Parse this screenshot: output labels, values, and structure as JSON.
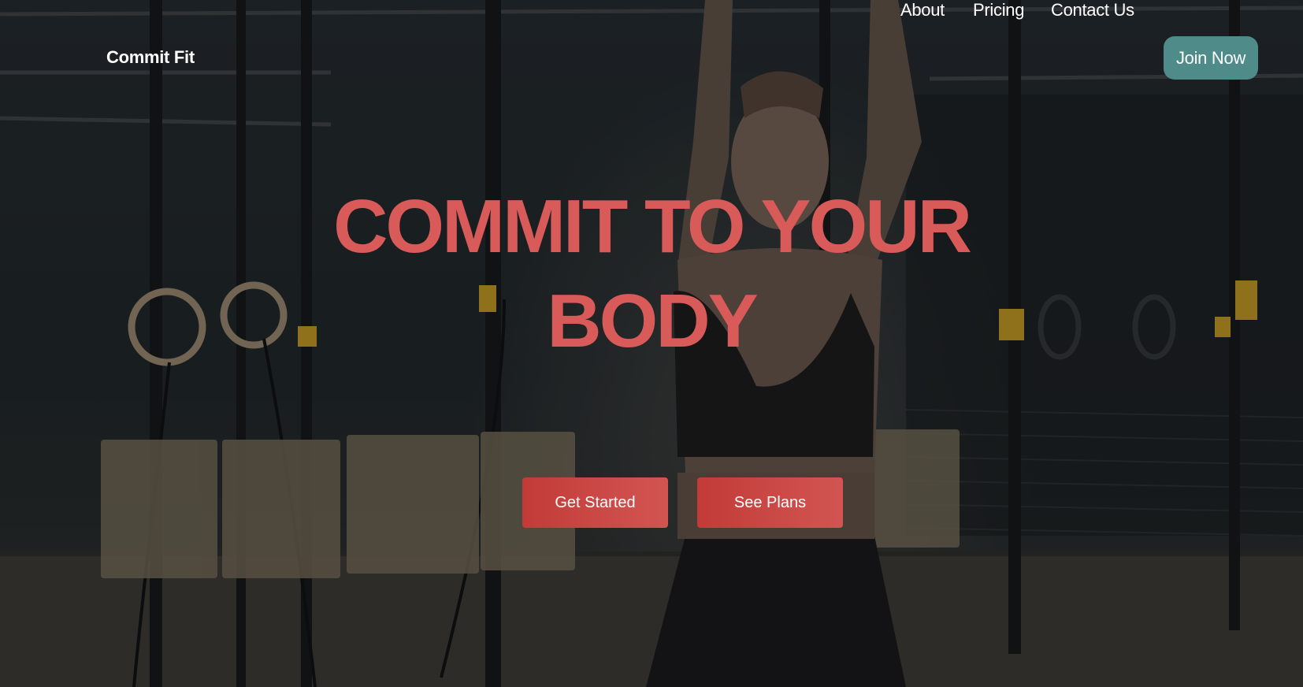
{
  "nav": {
    "brand": "Commit Fit",
    "links": [
      "About",
      "Pricing",
      "Contact Us"
    ],
    "join_label": "Join Now"
  },
  "hero": {
    "headline_line1": "COMMIT TO YOUR",
    "headline_line2": "BODY",
    "primary_cta": "Get Started",
    "secondary_cta": "See Plans"
  },
  "colors": {
    "headline": "#d85a59",
    "join_button": "#4f8c89",
    "cta_start": "#c23b38",
    "cta_end": "#d25552"
  }
}
